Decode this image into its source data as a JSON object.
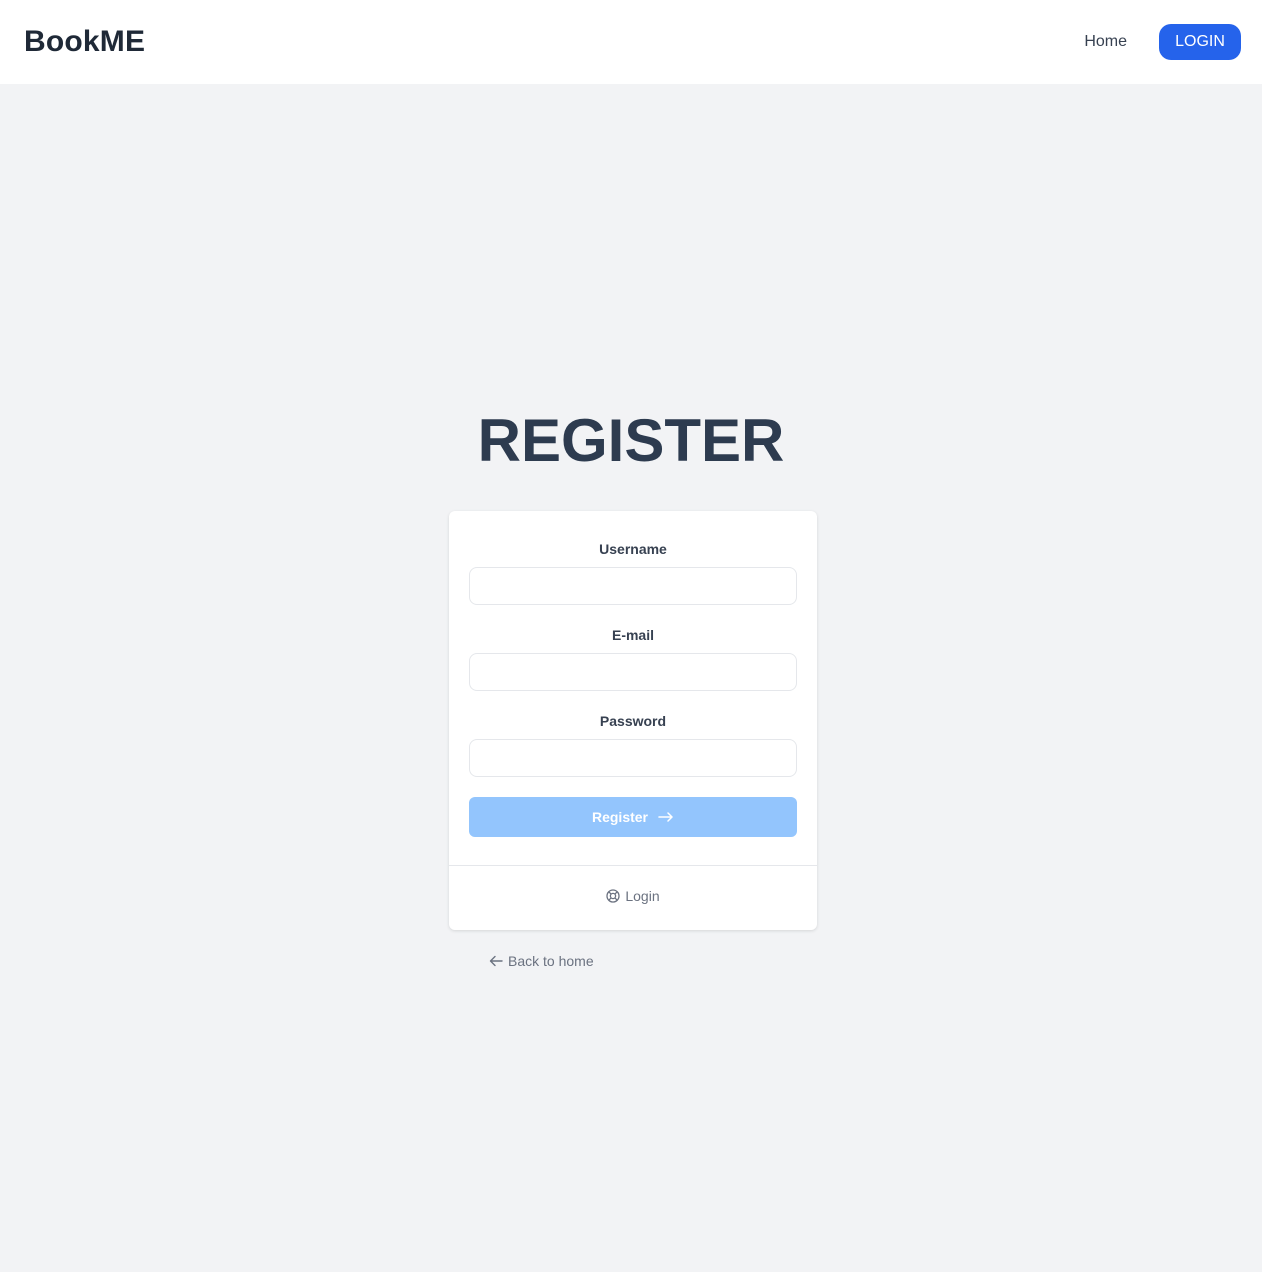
{
  "header": {
    "brand": "BookME",
    "home_label": "Home",
    "login_label": "LOGIN"
  },
  "page": {
    "title": "REGISTER"
  },
  "form": {
    "username_label": "Username",
    "username_value": "",
    "email_label": "E-mail",
    "email_value": "",
    "password_label": "Password",
    "password_value": "",
    "submit_label": "Register",
    "submit_icon": "arrow-right-icon",
    "login_link_label": "Login",
    "login_link_icon": "lifebuoy-icon"
  },
  "footer": {
    "back_label": "Back to home",
    "back_icon": "arrow-left-icon"
  },
  "colors": {
    "accent": "#2563eb",
    "submit_disabled": "#93c5fd",
    "background": "#f2f3f5",
    "title": "#2d3b4f"
  }
}
